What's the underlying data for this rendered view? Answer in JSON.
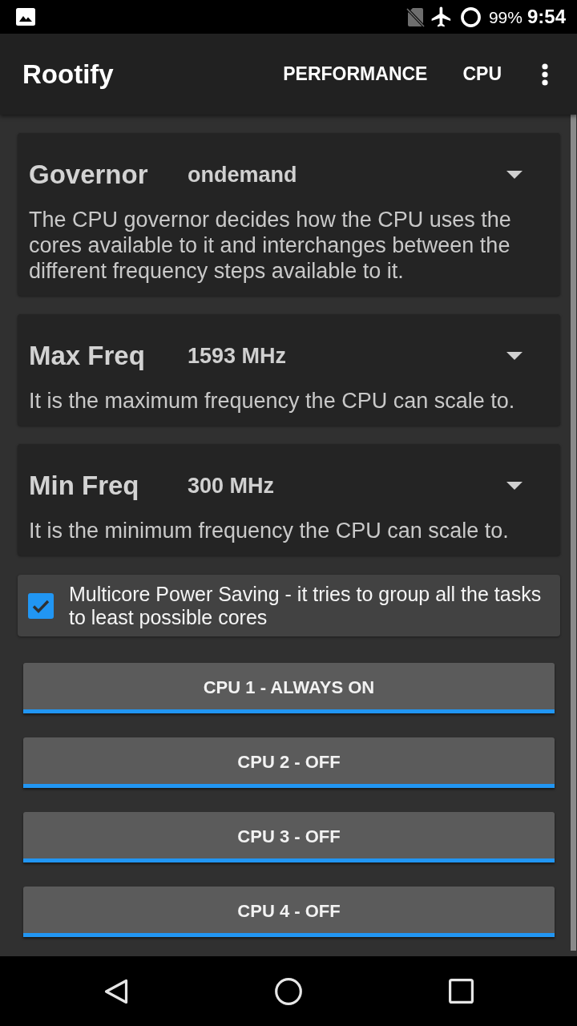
{
  "status_bar": {
    "battery": "99%",
    "time": "9:54"
  },
  "app_bar": {
    "title": "Rootify",
    "actions": [
      {
        "label": "PERFORMANCE"
      },
      {
        "label": "CPU"
      }
    ]
  },
  "settings": [
    {
      "title": "Governor",
      "value": "ondemand",
      "description": "The CPU governor decides how the CPU uses the cores available to it and interchanges between the different frequency steps available to it."
    },
    {
      "title": "Max Freq",
      "value": "1593 MHz",
      "description": "It is the maximum frequency the CPU can scale to."
    },
    {
      "title": "Min Freq",
      "value": "300 MHz",
      "description": "It is the minimum frequency the CPU can scale to."
    }
  ],
  "power_saving": {
    "label": "Multicore Power Saving - it tries to group all the tasks to least possible cores",
    "checked": true
  },
  "cpu_buttons": [
    {
      "label": "CPU 1 - ALWAYS ON"
    },
    {
      "label": "CPU 2 - OFF"
    },
    {
      "label": "CPU 3 - OFF"
    },
    {
      "label": "CPU 4 - OFF"
    }
  ]
}
